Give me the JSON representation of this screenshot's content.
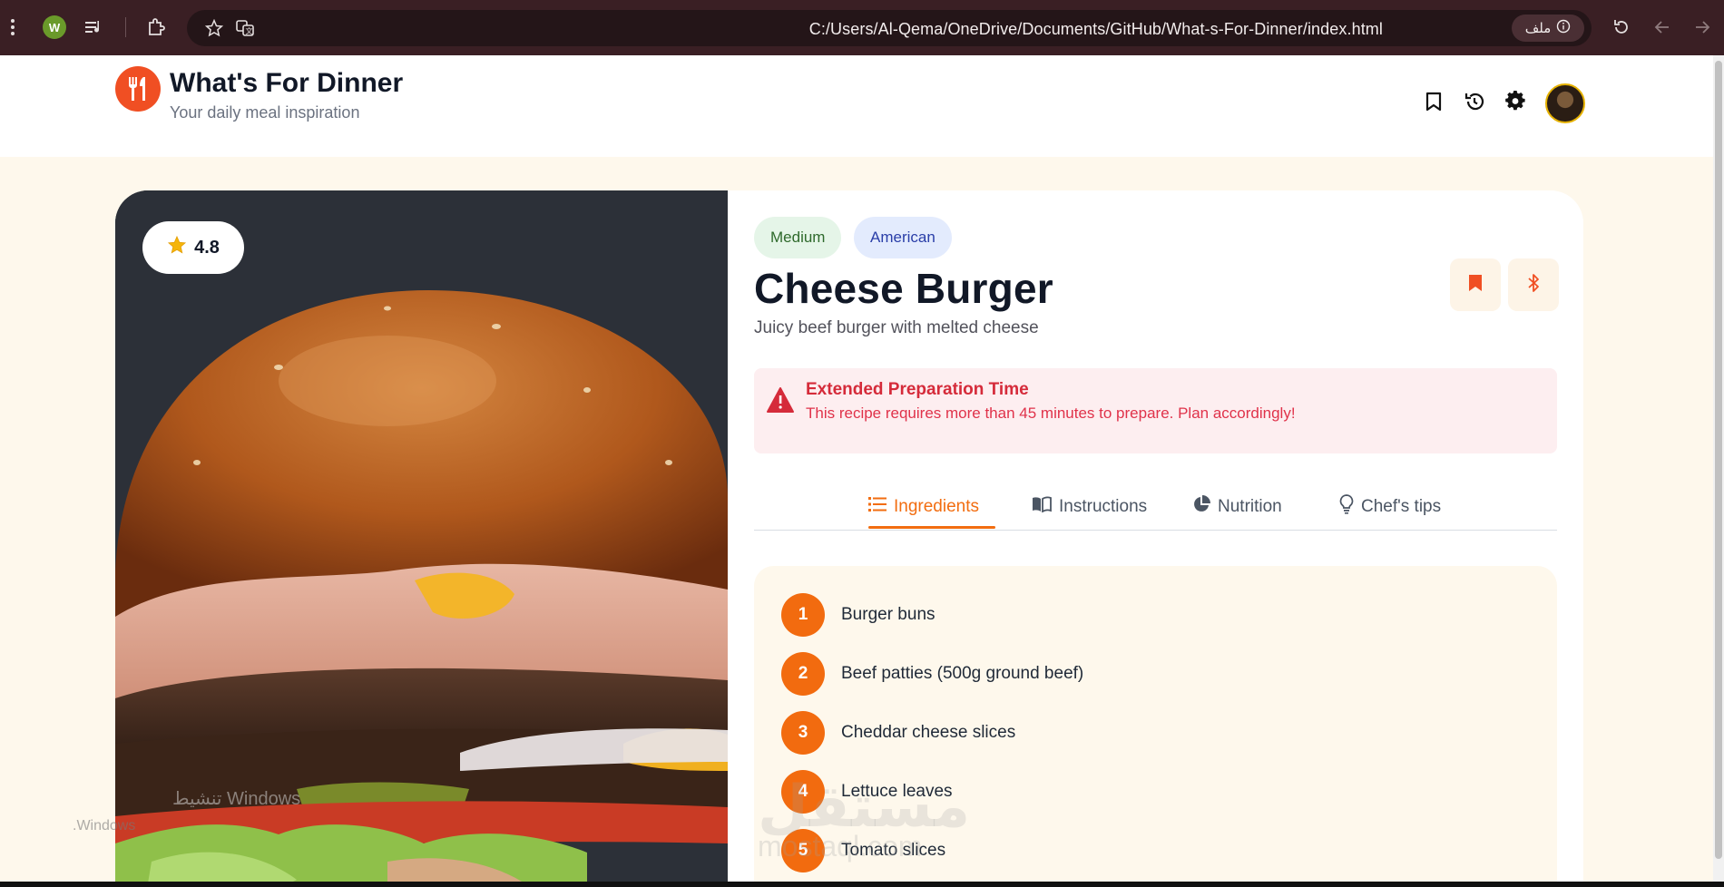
{
  "browser": {
    "extension_badge": "W",
    "url": "C:/Users/Al-Qema/OneDrive/Documents/GitHub/What-s-For-Dinner/index.html",
    "file_label": "ملف"
  },
  "header": {
    "title": "What's For Dinner",
    "subtitle": "Your daily meal inspiration"
  },
  "recipe": {
    "rating": "4.8",
    "difficulty": "Medium",
    "cuisine": "American",
    "title": "Cheese Burger",
    "description": "Juicy beef burger with melted cheese",
    "alert": {
      "title": "Extended Preparation Time",
      "text": "This recipe requires more than 45 minutes to prepare. Plan accordingly!"
    },
    "tabs": [
      {
        "label": "Ingredients",
        "icon": "list-icon",
        "active": true
      },
      {
        "label": "Instructions",
        "icon": "book-icon",
        "active": false
      },
      {
        "label": "Nutrition",
        "icon": "pie-chart-icon",
        "active": false
      },
      {
        "label": "Chef's tips",
        "icon": "lightbulb-icon",
        "active": false
      }
    ],
    "ingredients": [
      {
        "num": "1",
        "text": "Burger buns"
      },
      {
        "num": "2",
        "text": "Beef patties (500g ground beef)"
      },
      {
        "num": "3",
        "text": "Cheddar cheese slices"
      },
      {
        "num": "4",
        "text": "Lettuce leaves"
      },
      {
        "num": "5",
        "text": "Tomato slices"
      }
    ]
  },
  "overlays": {
    "watermark": "مستقل",
    "watermark_url": "mostaql.com",
    "windows_activation": "تنشيط Windows",
    "windows_activation_sub": ".Windows"
  },
  "colors": {
    "accent": "#f26d10",
    "brand": "#f04f23",
    "alert_red": "#d52b3a",
    "background_cream": "#fef8ec"
  }
}
